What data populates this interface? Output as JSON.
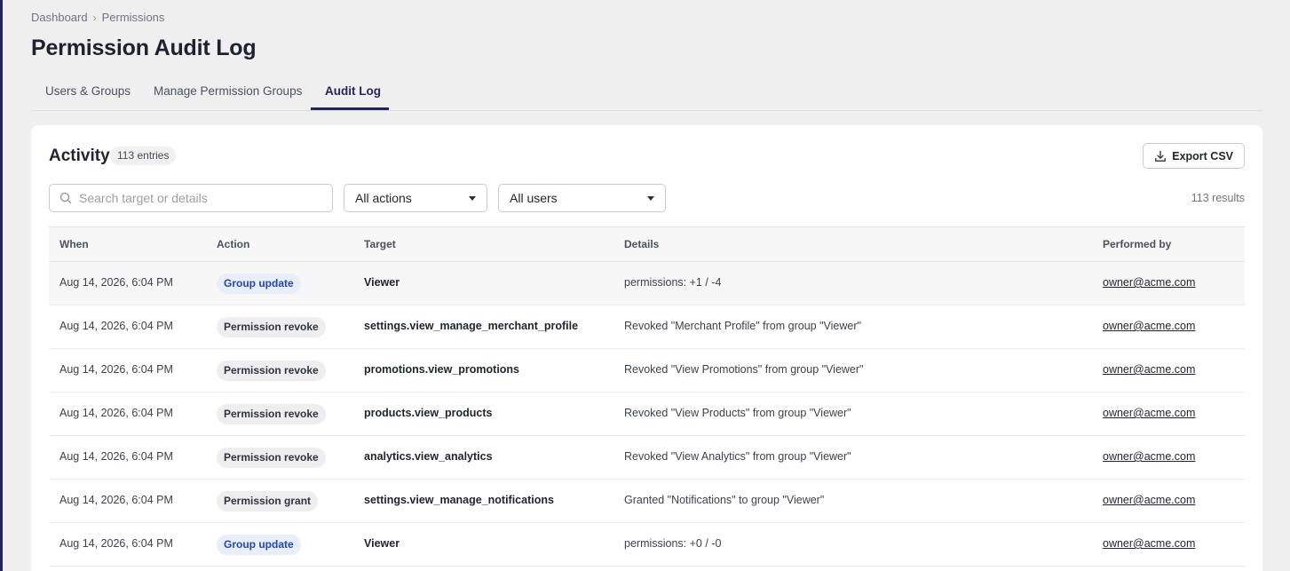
{
  "breadcrumb": {
    "items": [
      "Dashboard",
      "Permissions"
    ]
  },
  "page_title": "Permission Audit Log",
  "tabs": [
    {
      "label": "Users & Groups",
      "active": false
    },
    {
      "label": "Manage Permission Groups",
      "active": false
    },
    {
      "label": "Audit Log",
      "active": true
    }
  ],
  "activity": {
    "title": "Activity",
    "count_badge": "113 entries",
    "export_label": "Export CSV",
    "search_placeholder": "Search target or details",
    "action_filter": "All actions",
    "user_filter": "All users",
    "results_text": "113 results"
  },
  "table": {
    "columns": [
      "When",
      "Action",
      "Target",
      "Details",
      "Performed by"
    ],
    "rows": [
      {
        "when": "Aug 14, 2026, 6:04 PM",
        "action": "Group update",
        "action_style": "info",
        "target": "Viewer",
        "details": "permissions: +1 / -4",
        "by": "owner@acme.com"
      },
      {
        "when": "Aug 14, 2026, 6:04 PM",
        "action": "Permission revoke",
        "action_style": "neutral",
        "target": "settings.view_manage_merchant_profile",
        "details": "Revoked \"Merchant Profile\" from group \"Viewer\"",
        "by": "owner@acme.com"
      },
      {
        "when": "Aug 14, 2026, 6:04 PM",
        "action": "Permission revoke",
        "action_style": "neutral",
        "target": "promotions.view_promotions",
        "details": "Revoked \"View Promotions\" from group \"Viewer\"",
        "by": "owner@acme.com"
      },
      {
        "when": "Aug 14, 2026, 6:04 PM",
        "action": "Permission revoke",
        "action_style": "neutral",
        "target": "products.view_products",
        "details": "Revoked \"View Products\" from group \"Viewer\"",
        "by": "owner@acme.com"
      },
      {
        "when": "Aug 14, 2026, 6:04 PM",
        "action": "Permission revoke",
        "action_style": "neutral",
        "target": "analytics.view_analytics",
        "details": "Revoked \"View Analytics\" from group \"Viewer\"",
        "by": "owner@acme.com"
      },
      {
        "when": "Aug 14, 2026, 6:04 PM",
        "action": "Permission grant",
        "action_style": "neutral",
        "target": "settings.view_manage_notifications",
        "details": "Granted \"Notifications\" to group \"Viewer\"",
        "by": "owner@acme.com"
      },
      {
        "when": "Aug 14, 2026, 6:04 PM",
        "action": "Group update",
        "action_style": "info",
        "target": "Viewer",
        "details": "permissions: +0 / -0",
        "by": "owner@acme.com"
      }
    ]
  },
  "colors": {
    "accent": "#23265e",
    "info_badge_text": "#2346b5",
    "info_badge_bg": "#e9eefb",
    "page_bg": "#efefef"
  }
}
